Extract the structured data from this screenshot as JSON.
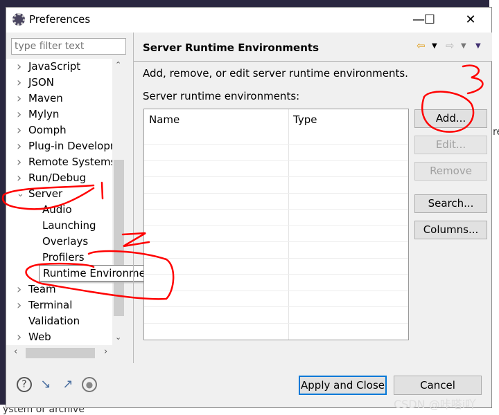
{
  "window": {
    "title": "Preferences",
    "app_icon": "eclipse-gear-icon"
  },
  "background": {
    "bottom_text": "ystem or archive",
    "right_text": "re"
  },
  "sidebar": {
    "filter_placeholder": "type filter text",
    "items": [
      {
        "label": "JavaScript",
        "expanded": false,
        "has_children": true
      },
      {
        "label": "JSON",
        "expanded": false,
        "has_children": true
      },
      {
        "label": "Maven",
        "expanded": false,
        "has_children": true
      },
      {
        "label": "Mylyn",
        "expanded": false,
        "has_children": true
      },
      {
        "label": "Oomph",
        "expanded": false,
        "has_children": true
      },
      {
        "label": "Plug-in Developr",
        "expanded": false,
        "has_children": true
      },
      {
        "label": "Remote Systems",
        "expanded": false,
        "has_children": true
      },
      {
        "label": "Run/Debug",
        "expanded": false,
        "has_children": true
      },
      {
        "label": "Server",
        "expanded": true,
        "has_children": true
      },
      {
        "label": "Audio",
        "child": true
      },
      {
        "label": "Launching",
        "child": true
      },
      {
        "label": "Overlays",
        "child": true
      },
      {
        "label": "Profilers",
        "child": true
      },
      {
        "label": "Runtime Environments",
        "child": true,
        "selected": true
      },
      {
        "label": "Team",
        "expanded": false,
        "has_children": true
      },
      {
        "label": "Terminal",
        "expanded": false,
        "has_children": true
      },
      {
        "label": "Validation",
        "has_children": false
      },
      {
        "label": "Web",
        "expanded": false,
        "has_children": true
      }
    ]
  },
  "main": {
    "title": "Server Runtime Environments",
    "description": "Add, remove, or edit server runtime environments.",
    "list_label": "Server runtime environments:",
    "columns": [
      "Name",
      "Type"
    ],
    "rows": [],
    "buttons": [
      {
        "label": "Add...",
        "enabled": true
      },
      {
        "label": "Edit...",
        "enabled": false
      },
      {
        "label": "Remove",
        "enabled": false
      },
      {
        "label": "Search...",
        "enabled": true
      },
      {
        "label": "Columns...",
        "enabled": true
      }
    ]
  },
  "footer": {
    "apply_close": "Apply and Close",
    "cancel": "Cancel",
    "icons": [
      "help-icon",
      "import-icon",
      "export-icon",
      "record-icon"
    ]
  },
  "watermark": "CSDN @咔嗒i吖",
  "colors": {
    "annotation": "#ff0000",
    "focus": "#0078d7"
  }
}
